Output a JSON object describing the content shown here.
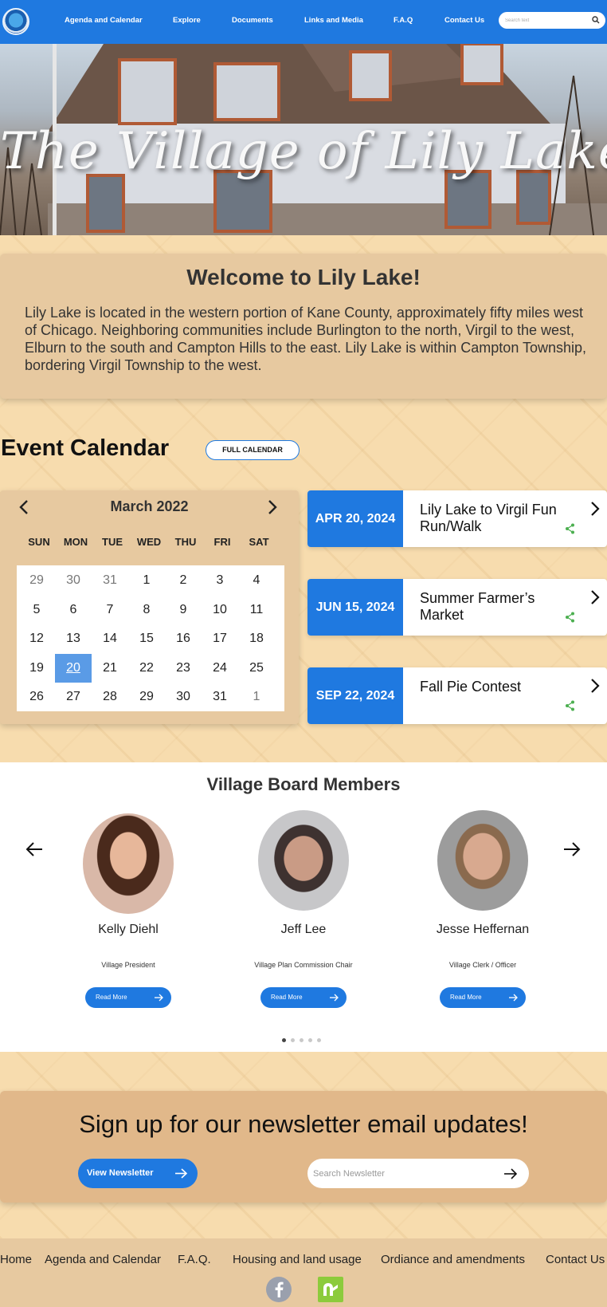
{
  "nav": {
    "links": [
      "Agenda and Calendar",
      "Explore",
      "Documents",
      "Links and Media",
      "F.A.Q",
      "Contact Us"
    ],
    "search_placeholder": "Search text"
  },
  "hero": {
    "title": "The Village of Lily Lake"
  },
  "welcome": {
    "title": "Welcome to Lily Lake!",
    "body": "Lily Lake is located in the western portion of Kane County, approximately fifty miles west of Chicago. Neighboring communities include Burlington to the north, Virgil to the west, Elburn to the south and Campton Hills to the east.  Lily Lake is  within Campton Township, bordering Virgil Township to the west."
  },
  "events": {
    "heading": "Event Calendar",
    "full_calendar_label": "FULL CALENDAR",
    "items": [
      {
        "date": "APR 20, 2024",
        "title": "Lily Lake to Virgil Fun Run/Walk"
      },
      {
        "date": "JUN 15, 2024",
        "title": "Summer Farmer’s Market"
      },
      {
        "date": "SEP 22, 2024",
        "title": "Fall Pie Contest"
      }
    ]
  },
  "calendar": {
    "month_label": "March 2022",
    "weekdays": [
      "SUN",
      "MON",
      "TUE",
      "WED",
      "THU",
      "FRI",
      "SAT"
    ],
    "weeks": [
      [
        "29",
        "30",
        "31",
        "1",
        "2",
        "3",
        "4"
      ],
      [
        "5",
        "6",
        "7",
        "8",
        "9",
        "10",
        "11"
      ],
      [
        "12",
        "13",
        "14",
        "15",
        "16",
        "17",
        "18"
      ],
      [
        "19",
        "20",
        "21",
        "22",
        "23",
        "24",
        "25"
      ],
      [
        "26",
        "27",
        "28",
        "29",
        "30",
        "31",
        "1"
      ]
    ],
    "selected_day": "20"
  },
  "board": {
    "title": "Village Board Members",
    "members": [
      {
        "name": "Kelly Diehl",
        "role": "Village President"
      },
      {
        "name": "Jeff Lee",
        "role": "Village Plan Commission Chair"
      },
      {
        "name": "Jesse Heffernan",
        "role": "Village Clerk / Officer"
      }
    ],
    "read_more_label": "Read More",
    "page_count": 5,
    "active_page": 1
  },
  "newsletter": {
    "title": "Sign up for our newsletter email updates!",
    "button_label": "View Newsletter",
    "search_placeholder": "Search Newsletter"
  },
  "footer": {
    "links": [
      "Home",
      "Agenda and Calendar",
      "F.A.Q.",
      "Housing and land usage",
      "Ordiance and amendments",
      "Contact Us"
    ]
  },
  "colors": {
    "primary": "#1f79e0",
    "page_background": "#f7dcae",
    "panel": "#e7c9a0",
    "share_green": "#4caf50"
  },
  "icons": [
    "logo",
    "search-icon",
    "chevron-left-icon",
    "chevron-right-icon",
    "share-icon",
    "arrow-left-icon",
    "arrow-right-icon",
    "facebook-icon",
    "nextdoor-icon"
  ]
}
